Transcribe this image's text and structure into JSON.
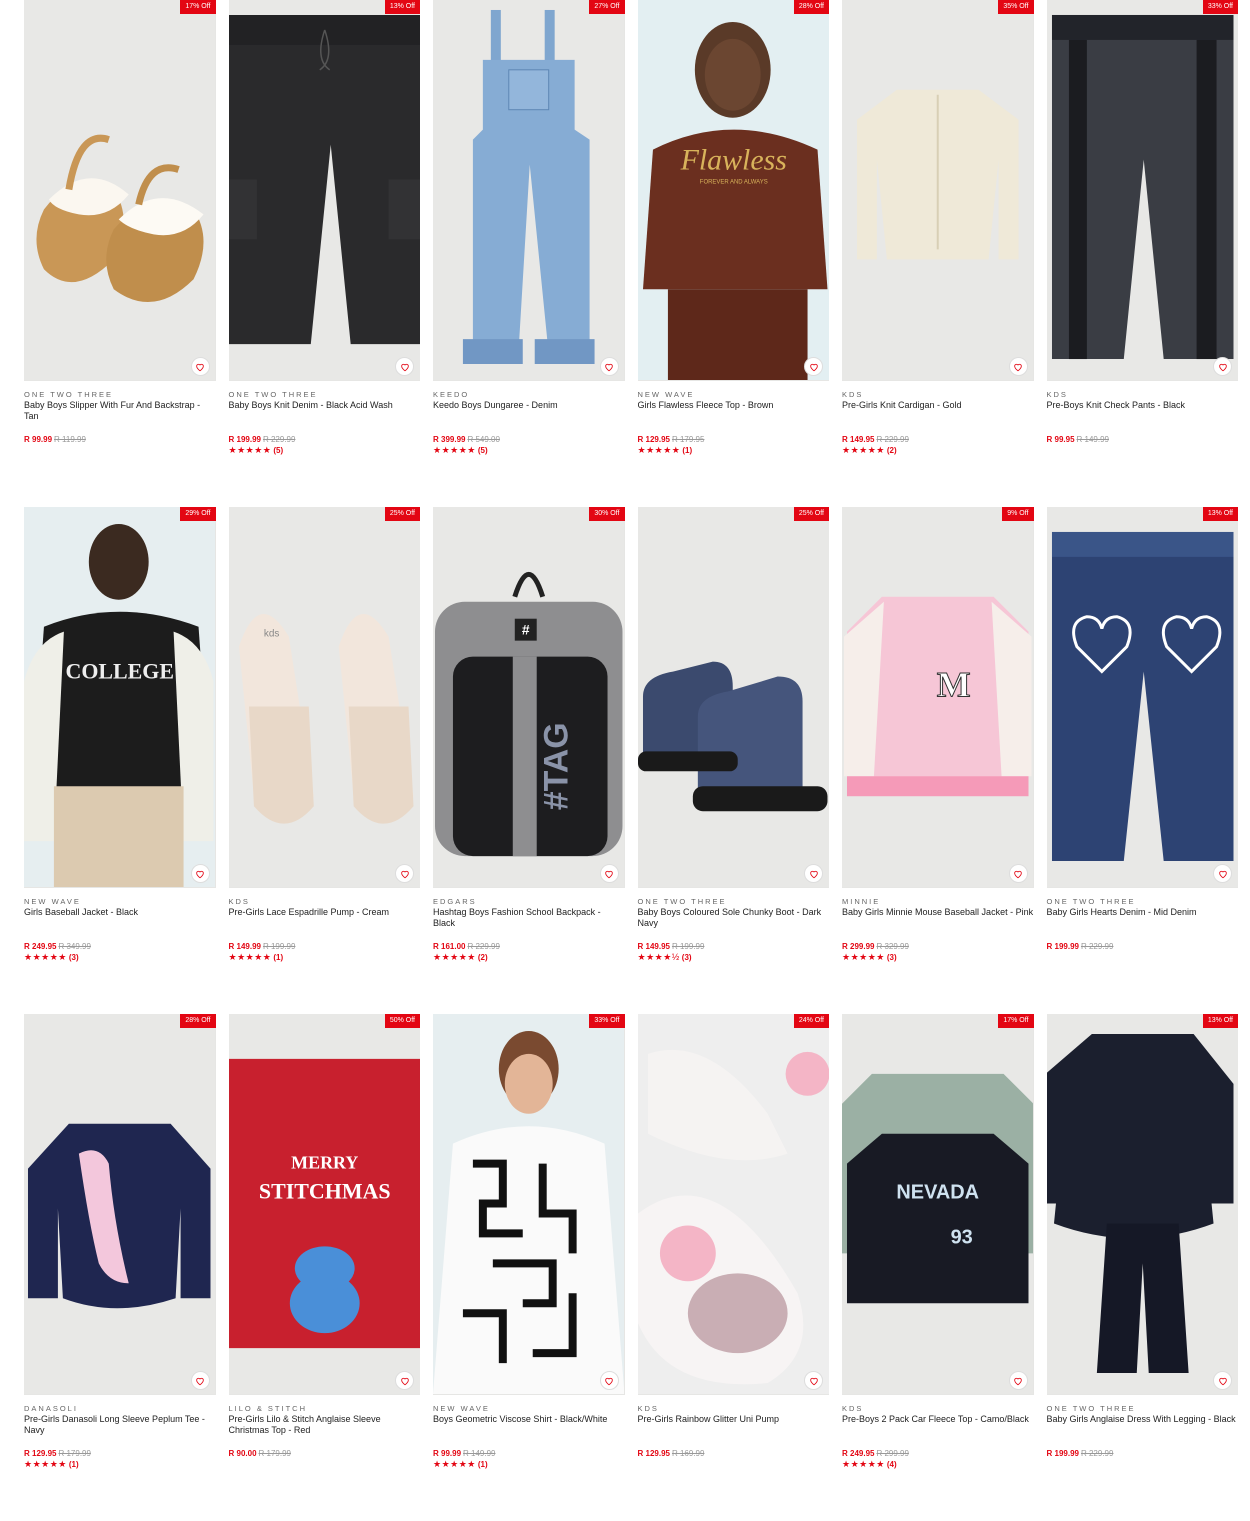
{
  "products": [
    {
      "discount": "17% Off",
      "brand": "ONE TWO THREE",
      "name": "Baby Boys Slipper With Fur And Backstrap - Tan",
      "price": "R 99.99",
      "was": "R 119.99",
      "rating_count": "",
      "stars": "",
      "image": "slippers"
    },
    {
      "discount": "13% Off",
      "brand": "ONE TWO THREE",
      "name": "Baby Boys Knit Denim - Black Acid Wash",
      "price": "R 199.99",
      "was": "R 229.99",
      "rating_count": "(5)",
      "stars": "★★★★★",
      "image": "black-pants"
    },
    {
      "discount": "27% Off",
      "brand": "KEEDO",
      "name": "Keedo Boys Dungaree - Denim",
      "price": "R 399.99",
      "was": "R 549.00",
      "rating_count": "(5)",
      "stars": "★★★★★",
      "image": "dungaree"
    },
    {
      "discount": "28% Off",
      "brand": "NEW WAVE",
      "name": "Girls Flawless Fleece Top - Brown",
      "price": "R 129.95",
      "was": "R 179.95",
      "rating_count": "(1)",
      "stars": "★★★★★",
      "image": "brown-hoodie"
    },
    {
      "discount": "35% Off",
      "brand": "KDS",
      "name": "Pre-Girls Knit Cardigan - Gold",
      "price": "R 149.95",
      "was": "R 229.99",
      "rating_count": "(2)",
      "stars": "★★★★★",
      "image": "cardigan"
    },
    {
      "discount": "33% Off",
      "brand": "KDS",
      "name": "Pre-Boys Knit Check Pants - Black",
      "price": "R 99.95",
      "was": "R 149.99",
      "rating_count": "",
      "stars": "",
      "image": "check-pants"
    },
    {
      "discount": "29% Off",
      "brand": "NEW WAVE",
      "name": "Girls Baseball Jacket - Black",
      "price": "R 249.95",
      "was": "R 349.99",
      "rating_count": "(3)",
      "stars": "★★★★★",
      "image": "college-jacket"
    },
    {
      "discount": "25% Off",
      "brand": "KDS",
      "name": "Pre-Girls Lace Espadrille Pump - Cream",
      "price": "R 149.99",
      "was": "R 199.99",
      "rating_count": "(1)",
      "stars": "★★★★★",
      "image": "espadrille"
    },
    {
      "discount": "30% Off",
      "brand": "EDGARS",
      "name": "Hashtag Boys Fashion School Backpack - Black",
      "price": "R 161.00",
      "was": "R 229.99",
      "rating_count": "(2)",
      "stars": "★★★★★",
      "image": "backpack"
    },
    {
      "discount": "25% Off",
      "brand": "ONE TWO THREE",
      "name": "Baby Boys Coloured Sole Chunky Boot - Dark Navy",
      "price": "R 149.95",
      "was": "R 199.99",
      "rating_count": "(3)",
      "stars": "★★★★½",
      "image": "boots"
    },
    {
      "discount": "9% Off",
      "brand": "MINNIE",
      "name": "Baby Girls Minnie Mouse Baseball Jacket - Pink",
      "price": "R 299.99",
      "was": "R 329.99",
      "rating_count": "(3)",
      "stars": "★★★★★",
      "image": "pink-jacket"
    },
    {
      "discount": "13% Off",
      "brand": "ONE TWO THREE",
      "name": "Baby Girls Hearts Denim - Mid Denim",
      "price": "R 199.99",
      "was": "R 229.99",
      "rating_count": "",
      "stars": "",
      "image": "heart-jeans"
    },
    {
      "discount": "28% Off",
      "brand": "DANASOLI",
      "name": "Pre-Girls Danasoli Long Sleeve Peplum Tee - Navy",
      "price": "R 129.95",
      "was": "R 179.99",
      "rating_count": "(1)",
      "stars": "★★★★★",
      "image": "navy-peplum"
    },
    {
      "discount": "50% Off",
      "brand": "LILO & STITCH",
      "name": "Pre-Girls Lilo & Stitch Anglaise Sleeve Christmas Top - Red",
      "price": "R 90.00",
      "was": "R 179.99",
      "rating_count": "",
      "stars": "",
      "image": "stitch-top"
    },
    {
      "discount": "33% Off",
      "brand": "NEW WAVE",
      "name": "Boys Geometric Viscose Shirt - Black/White",
      "price": "R 99.99",
      "was": "R 149.99",
      "rating_count": "(1)",
      "stars": "★★★★★",
      "image": "geo-shirt"
    },
    {
      "discount": "24% Off",
      "brand": "KDS",
      "name": "Pre-Girls Rainbow Glitter Uni Pump",
      "price": "R 129.95",
      "was": "R 169.99",
      "rating_count": "",
      "stars": "",
      "image": "glitter-pump"
    },
    {
      "discount": "17% Off",
      "brand": "KDS",
      "name": "Pre-Boys 2 Pack Car Fleece Top - Camo/Black",
      "price": "R 249.95",
      "was": "R 299.99",
      "rating_count": "(4)",
      "stars": "★★★★★",
      "image": "camo-tops"
    },
    {
      "discount": "13% Off",
      "brand": "ONE TWO THREE",
      "name": "Baby Girls Anglaise Dress With Legging - Black",
      "price": "R 199.99",
      "was": "R 229.99",
      "rating_count": "",
      "stars": "",
      "image": "black-dress"
    }
  ],
  "artwork_text": {
    "flawless": "Flawless",
    "flawless_sub": "FOREVER AND ALWAYS",
    "college": "COLLEGE",
    "tag": "#TAG",
    "hash": "#",
    "merry": "MERRY",
    "stitchmas": "STITCHMAS",
    "nevada": "NEVADA",
    "nevada_num": "93",
    "minnie_m": "M",
    "kds": "kds"
  },
  "colors": {
    "accent": "#e30613",
    "image_bg": "#e6e6e4"
  }
}
